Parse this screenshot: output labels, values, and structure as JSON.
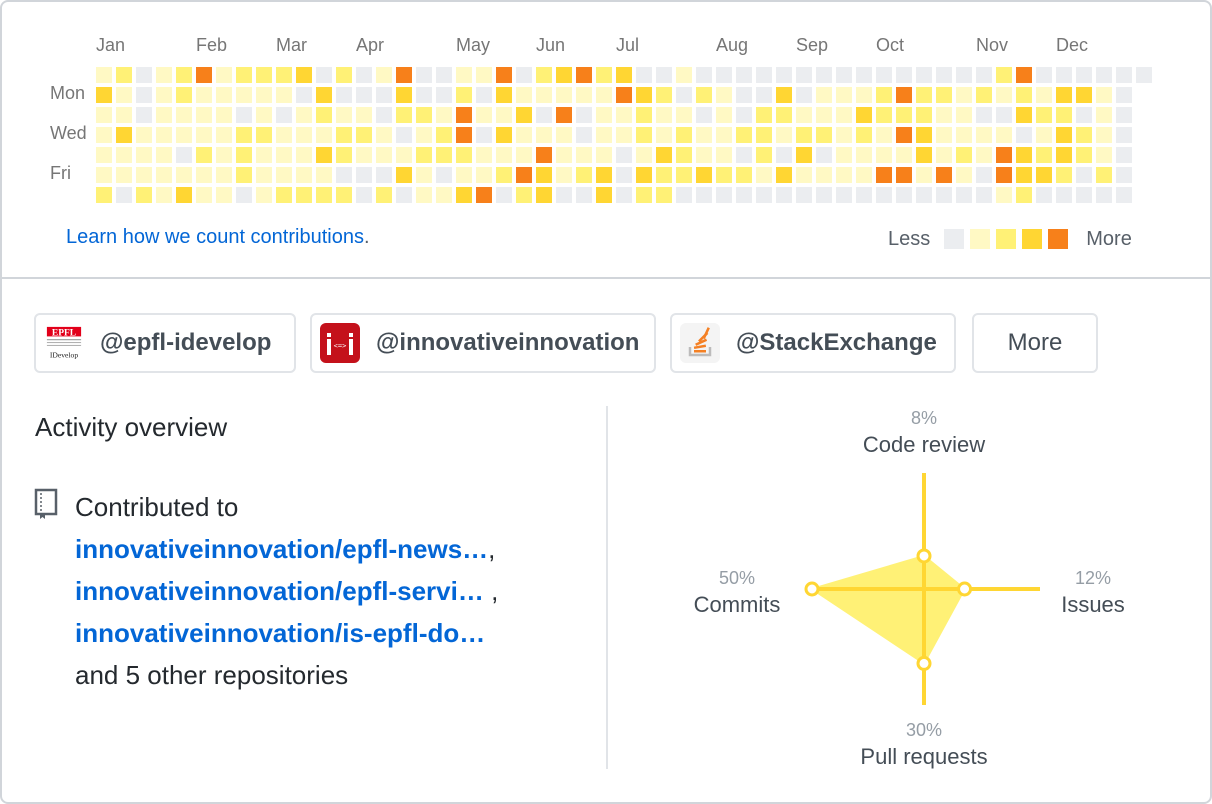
{
  "calendar": {
    "months": [
      {
        "label": "Jan",
        "week": 0
      },
      {
        "label": "Feb",
        "week": 5
      },
      {
        "label": "Mar",
        "week": 9
      },
      {
        "label": "Apr",
        "week": 13
      },
      {
        "label": "May",
        "week": 18
      },
      {
        "label": "Jun",
        "week": 22
      },
      {
        "label": "Jul",
        "week": 26
      },
      {
        "label": "Aug",
        "week": 31
      },
      {
        "label": "Sep",
        "week": 35
      },
      {
        "label": "Oct",
        "week": 39
      },
      {
        "label": "Nov",
        "week": 44
      },
      {
        "label": "Dec",
        "week": 48
      }
    ],
    "day_labels": [
      {
        "label": "Mon",
        "day": 1
      },
      {
        "label": "Wed",
        "day": 3
      },
      {
        "label": "Fri",
        "day": 5
      }
    ],
    "level_colors": [
      "#ebedf0",
      "#fff9c4",
      "#fff176",
      "#ffd633",
      "#f7801a"
    ],
    "weeks": [
      [
        1,
        3,
        1,
        1,
        1,
        1,
        2
      ],
      [
        2,
        1,
        1,
        3,
        1,
        1,
        0
      ],
      [
        0,
        0,
        0,
        1,
        1,
        1,
        2
      ],
      [
        1,
        1,
        1,
        1,
        1,
        1,
        1
      ],
      [
        2,
        2,
        1,
        1,
        0,
        1,
        3
      ],
      [
        4,
        1,
        1,
        1,
        2,
        1,
        1
      ],
      [
        1,
        1,
        1,
        1,
        1,
        1,
        1
      ],
      [
        2,
        1,
        0,
        2,
        2,
        2,
        0
      ],
      [
        2,
        1,
        1,
        2,
        1,
        1,
        1
      ],
      [
        2,
        1,
        0,
        1,
        1,
        1,
        2
      ],
      [
        3,
        0,
        1,
        1,
        1,
        1,
        2
      ],
      [
        0,
        3,
        2,
        1,
        3,
        1,
        2
      ],
      [
        2,
        0,
        1,
        2,
        2,
        0,
        2
      ],
      [
        0,
        0,
        1,
        2,
        1,
        0,
        0
      ],
      [
        1,
        0,
        0,
        1,
        1,
        0,
        2
      ],
      [
        4,
        3,
        2,
        0,
        1,
        3,
        0
      ],
      [
        0,
        0,
        2,
        1,
        2,
        1,
        1
      ],
      [
        0,
        0,
        1,
        2,
        2,
        0,
        1
      ],
      [
        1,
        2,
        4,
        4,
        2,
        1,
        3
      ],
      [
        1,
        0,
        1,
        0,
        1,
        1,
        4
      ],
      [
        4,
        3,
        1,
        3,
        1,
        2,
        0
      ],
      [
        0,
        1,
        3,
        1,
        1,
        4,
        2
      ],
      [
        2,
        1,
        0,
        1,
        4,
        3,
        3
      ],
      [
        3,
        1,
        4,
        1,
        1,
        1,
        0
      ],
      [
        4,
        1,
        0,
        0,
        1,
        2,
        0
      ],
      [
        2,
        1,
        1,
        1,
        1,
        3,
        3
      ],
      [
        3,
        4,
        1,
        1,
        0,
        0,
        0
      ],
      [
        0,
        3,
        2,
        2,
        1,
        3,
        2
      ],
      [
        0,
        2,
        1,
        1,
        3,
        2,
        2
      ],
      [
        1,
        0,
        1,
        2,
        2,
        2,
        0
      ],
      [
        0,
        2,
        0,
        1,
        1,
        3,
        0
      ],
      [
        0,
        1,
        1,
        1,
        1,
        2,
        0
      ],
      [
        0,
        0,
        0,
        2,
        0,
        2,
        0
      ],
      [
        0,
        0,
        2,
        2,
        2,
        1,
        0
      ],
      [
        0,
        3,
        2,
        1,
        0,
        3,
        0
      ],
      [
        0,
        0,
        1,
        2,
        3,
        1,
        0
      ],
      [
        0,
        1,
        1,
        2,
        0,
        1,
        0
      ],
      [
        0,
        1,
        1,
        1,
        1,
        1,
        0
      ],
      [
        0,
        1,
        3,
        2,
        1,
        1,
        0
      ],
      [
        0,
        2,
        2,
        1,
        1,
        4,
        0
      ],
      [
        0,
        4,
        2,
        4,
        1,
        4,
        0
      ],
      [
        0,
        2,
        2,
        3,
        3,
        1,
        0
      ],
      [
        0,
        2,
        1,
        1,
        1,
        4,
        0
      ],
      [
        0,
        1,
        1,
        1,
        2,
        1,
        0
      ],
      [
        0,
        2,
        0,
        1,
        1,
        0,
        0
      ],
      [
        2,
        1,
        0,
        1,
        4,
        4,
        1
      ],
      [
        4,
        2,
        3,
        0,
        3,
        3,
        2
      ],
      [
        0,
        1,
        2,
        1,
        2,
        3,
        0
      ],
      [
        0,
        3,
        2,
        3,
        3,
        2,
        0
      ],
      [
        0,
        3,
        0,
        2,
        2,
        0,
        0
      ],
      [
        0,
        1,
        1,
        1,
        1,
        2,
        0
      ],
      [
        0,
        0,
        0,
        0,
        0,
        0,
        0
      ],
      [
        0
      ]
    ],
    "learn_link": "Learn how we count contributions",
    "learn_link_suffix": ".",
    "legend": {
      "less": "Less",
      "more": "More"
    }
  },
  "orgs": [
    {
      "name": "@epfl-idevelop",
      "avatar": "epfl-idevelop-logo",
      "avatar_text": "EPFL",
      "avatar_sub": "IDevelop"
    },
    {
      "name": "@innovativeinnovation",
      "avatar": "innovativeinnovation-logo",
      "avatar_text": "i<=>i"
    },
    {
      "name": "@StackExchange",
      "avatar": "stackexchange-logo"
    }
  ],
  "more_button": "More",
  "activity": {
    "title": "Activity overview",
    "contributed_to": "Contributed to",
    "repos": [
      {
        "name": "innovativeinnovation/epfl-news…",
        "sep": ","
      },
      {
        "name": "innovativeinnovation/epfl-servi…",
        "sep": " ,"
      },
      {
        "name": "innovativeinnovation/is-epfl-do…",
        "sep": ""
      }
    ],
    "others": "and 5 other repositories"
  },
  "chart_data": {
    "type": "radar",
    "axes": [
      {
        "name": "Code review",
        "value": 8,
        "label": "8%",
        "direction": "top"
      },
      {
        "name": "Issues",
        "value": 12,
        "label": "12%",
        "direction": "right"
      },
      {
        "name": "Pull requests",
        "value": 30,
        "label": "30%",
        "direction": "bottom"
      },
      {
        "name": "Commits",
        "value": 50,
        "label": "50%",
        "direction": "left"
      }
    ],
    "unit": "%",
    "color": "#ffd633",
    "fill_color": "#fff176"
  }
}
